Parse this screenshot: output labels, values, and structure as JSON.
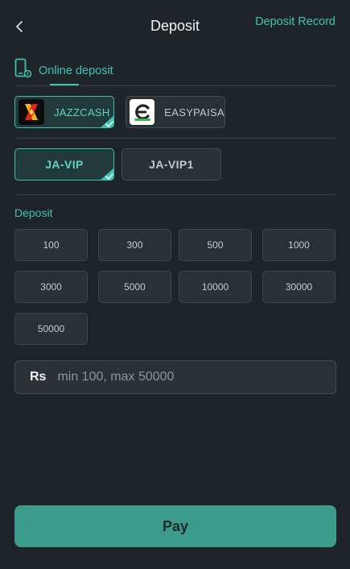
{
  "header": {
    "title": "Deposit",
    "record_label": "Deposit Record"
  },
  "tabs": [
    {
      "label": "Online deposit",
      "active": true
    }
  ],
  "methods": [
    {
      "label": "JAZZCASH",
      "active": true
    },
    {
      "label": "EASYPAISA",
      "active": false
    }
  ],
  "channels": [
    {
      "label": "JA-VIP",
      "active": true
    },
    {
      "label": "JA-VIP1",
      "active": false
    }
  ],
  "deposit": {
    "section_label": "Deposit",
    "amounts": [
      "100",
      "300",
      "500",
      "1000",
      "3000",
      "5000",
      "10000",
      "30000",
      "50000"
    ]
  },
  "input": {
    "currency": "Rs",
    "placeholder": "min 100, max 50000",
    "value": ""
  },
  "pay_label": "Pay",
  "colors": {
    "accent": "#3ec3b0",
    "background": "#1f2428",
    "pay_button": "#3c9b8a"
  }
}
